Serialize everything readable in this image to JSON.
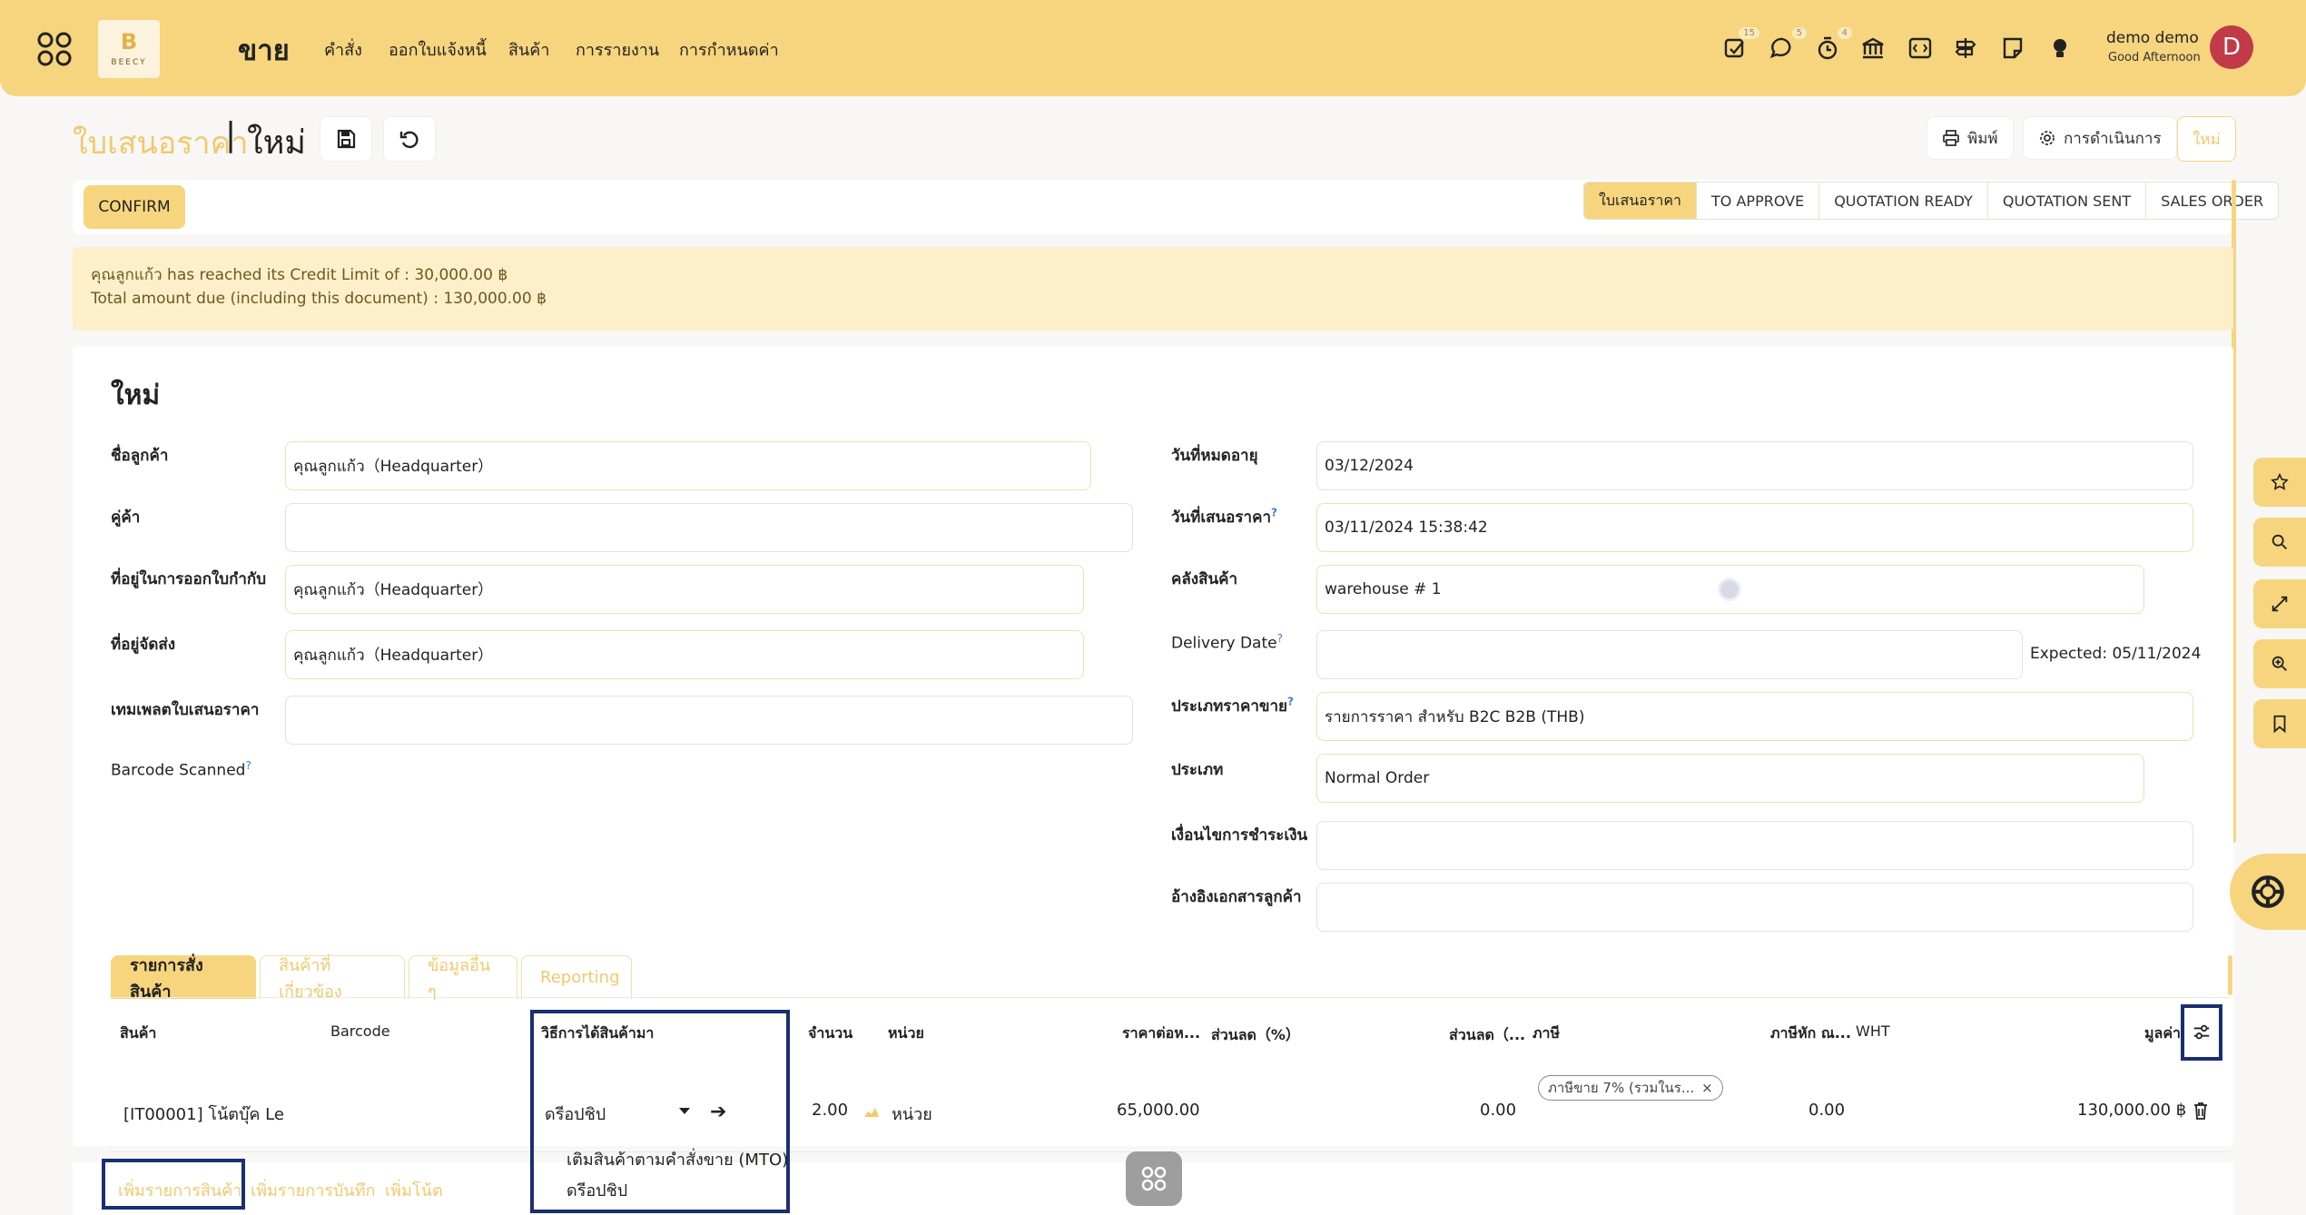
{
  "nav": {
    "brand": "ขาย",
    "menu": [
      "คำสั่ง",
      "ออกใบแจ้งหนี้",
      "สินค้า",
      "การรายงาน",
      "การกำหนดค่า"
    ],
    "badges": {
      "activity": "15",
      "messages": "5",
      "timer": "4"
    },
    "user_name": "demo demo",
    "user_greeting": "Good Afternoon",
    "avatar_letter": "D",
    "logo_text": "BEECY"
  },
  "breadcrumb": {
    "parent": "ใบเสนอราคา",
    "separator": "|",
    "current": "ใหม่"
  },
  "actions": {
    "print_label": "พิมพ์",
    "action_label": "การดำเนินการ",
    "new_label": "ใหม่"
  },
  "status": {
    "confirm_label": "CONFIRM",
    "steps": [
      "ใบเสนอราคา",
      "TO APPROVE",
      "QUOTATION READY",
      "QUOTATION SENT",
      "SALES ORDER"
    ],
    "active_step": 0
  },
  "warning": {
    "line1": "คุณลูกแก้ว has reached its Credit Limit of : 30,000.00 ฿",
    "line2": "Total amount due (including this document) : 130,000.00 ฿"
  },
  "form": {
    "title": "ใหม่",
    "left": {
      "customer_label": "ชื่อลูกค้า",
      "customer_value": "คุณลูกแก้ว（Headquarter）",
      "partner_label": "คู่ค้า",
      "partner_value": "",
      "invoice_addr_label": "ที่อยู่ในการออกใบกำกับ",
      "invoice_addr_value": "คุณลูกแก้ว（Headquarter）",
      "delivery_addr_label": "ที่อยู่จัดส่ง",
      "delivery_addr_value": "คุณลูกแก้ว（Headquarter）",
      "template_label": "เทมเพลตใบเสนอราคา",
      "template_value": "",
      "barcode_label": "Barcode Scanned",
      "help_mark": "?"
    },
    "right": {
      "expiry_label": "วันที่หมดอายุ",
      "expiry_value": "03/12/2024",
      "quote_date_label": "วันที่เสนอราคา",
      "quote_date_value": "03/11/2024 15:38:42",
      "warehouse_label": "คลังสินค้า",
      "warehouse_value": "warehouse # 1",
      "delivery_date_label": "Delivery Date",
      "delivery_date_value": "",
      "expected_text": "Expected: 05/11/2024",
      "pricelist_label": "ประเภทราคาขาย",
      "pricelist_value": "รายการราคา สำหรับ B2C B2B (THB)",
      "type_label": "ประเภท",
      "type_value": "Normal Order",
      "payment_terms_label": "เงื่อนไขการชำระเงิน",
      "payment_terms_value": "",
      "customer_ref_label": "อ้างอิงเอกสารลูกค้า",
      "customer_ref_value": ""
    }
  },
  "tabs": [
    "รายการสั่งสินค้า",
    "สินค้าที่เกี่ยวข้อง",
    "ข้อมูลอื่น ๆ",
    "Reporting"
  ],
  "table": {
    "headers": {
      "product": "สินค้า",
      "barcode": "Barcode",
      "route": "วิธีการได้สินค้ามา",
      "qty": "จำนวน",
      "unit": "หน่วย",
      "unit_price": "ราคาต่อห...",
      "discount_pct": "ส่วนลด（%）",
      "discount_amt": "ส่วนลด（...",
      "tax": "ภาษี",
      "wht_deduct": "ภาษีหัก ณ...",
      "wht": "WHT",
      "amount": "มูลค่า"
    },
    "row": {
      "product": "[IT00001] โน้ตบุ๊ค Le",
      "route": "ดรีอปชิป",
      "qty": "2.00",
      "unit": "หน่วย",
      "unit_price": "65,000.00",
      "discount_amt": "0.00",
      "tax_tag": "ภาษีขาย 7% (รวมในร...",
      "wht_deduct": "0.00",
      "amount": "130,000.00 ฿"
    },
    "route_options": [
      "เติมสินค้าตามคำสั่งขาย (MTO)",
      "ดรีอปชิป"
    ]
  },
  "add_links": {
    "add_product": "เพิ่มรายการสินค้า",
    "add_note": "เพิ่มรายการบันทึก",
    "add_section": "เพิ่มโน้ต"
  }
}
